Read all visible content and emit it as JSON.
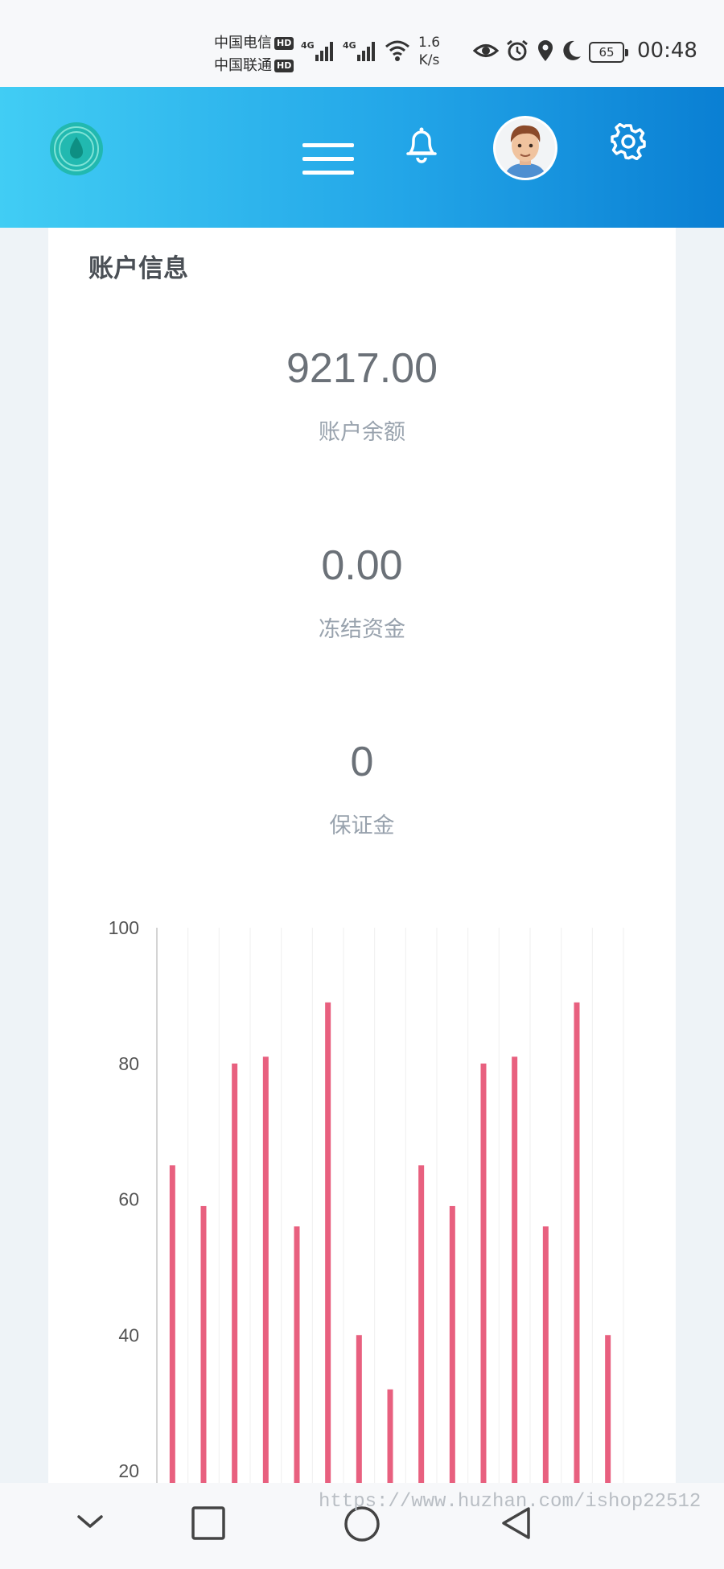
{
  "status_bar": {
    "carrier_1": "中国电信",
    "carrier_2": "中国联通",
    "hd_label": "HD",
    "net_speed_value": "1.6",
    "net_speed_unit": "K/s",
    "battery_level": "65",
    "time": "00:48",
    "signal_label": "4G"
  },
  "header": {
    "logo_icon": "droplet-logo-icon",
    "menu_icon": "hamburger-menu-icon",
    "notification_icon": "bell-icon",
    "avatar_icon": "avatar",
    "settings_icon": "gear-icon",
    "gradient_colors": [
      "#41cdf4",
      "#0a7fd3"
    ]
  },
  "account": {
    "title": "账户信息",
    "stats": [
      {
        "value": "9217.00",
        "label": "账户余额"
      },
      {
        "value": "0.00",
        "label": "冻结资金"
      },
      {
        "value": "0",
        "label": "保证金"
      }
    ]
  },
  "chart_data": {
    "type": "bar",
    "bar_color": "#e8607f",
    "y_ticks": [
      "100",
      "80",
      "60",
      "40",
      "20"
    ],
    "ylim": [
      20,
      100
    ],
    "grid": true,
    "values": [
      65,
      59,
      80,
      81,
      56,
      89,
      40,
      32,
      65,
      59,
      80,
      81,
      56,
      89,
      40
    ]
  },
  "nav_bar": {
    "back_icon": "chevron-down-icon",
    "recents_icon": "square-icon",
    "home_icon": "circle-icon",
    "back_triangle_icon": "triangle-back-icon"
  },
  "watermark": "https://www.huzhan.com/ishop22512"
}
